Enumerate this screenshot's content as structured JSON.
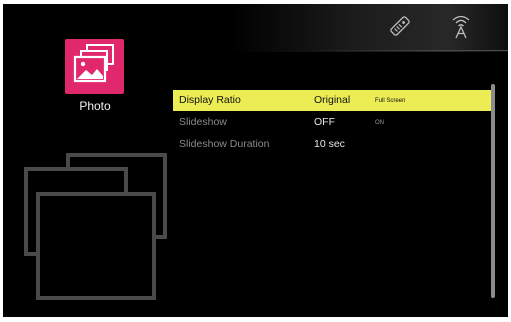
{
  "category": {
    "label": "Photo",
    "icon": "photo-gallery-icon",
    "accent_color": "#e2286d"
  },
  "status_icons": [
    {
      "name": "remote-control-icon"
    },
    {
      "name": "wireless-signal-icon"
    }
  ],
  "settings": [
    {
      "label": "Display Ratio",
      "value": "Original",
      "alternate": "Full Screen",
      "selected": true
    },
    {
      "label": "Slideshow",
      "value": "OFF",
      "alternate": "ON",
      "selected": false
    },
    {
      "label": "Slideshow Duration",
      "value": "10 sec",
      "alternate": "",
      "selected": false
    }
  ],
  "colors": {
    "selection": "#ecec54",
    "background": "#000000"
  },
  "scrollbar": {
    "icon": "vertical-scrollbar"
  }
}
